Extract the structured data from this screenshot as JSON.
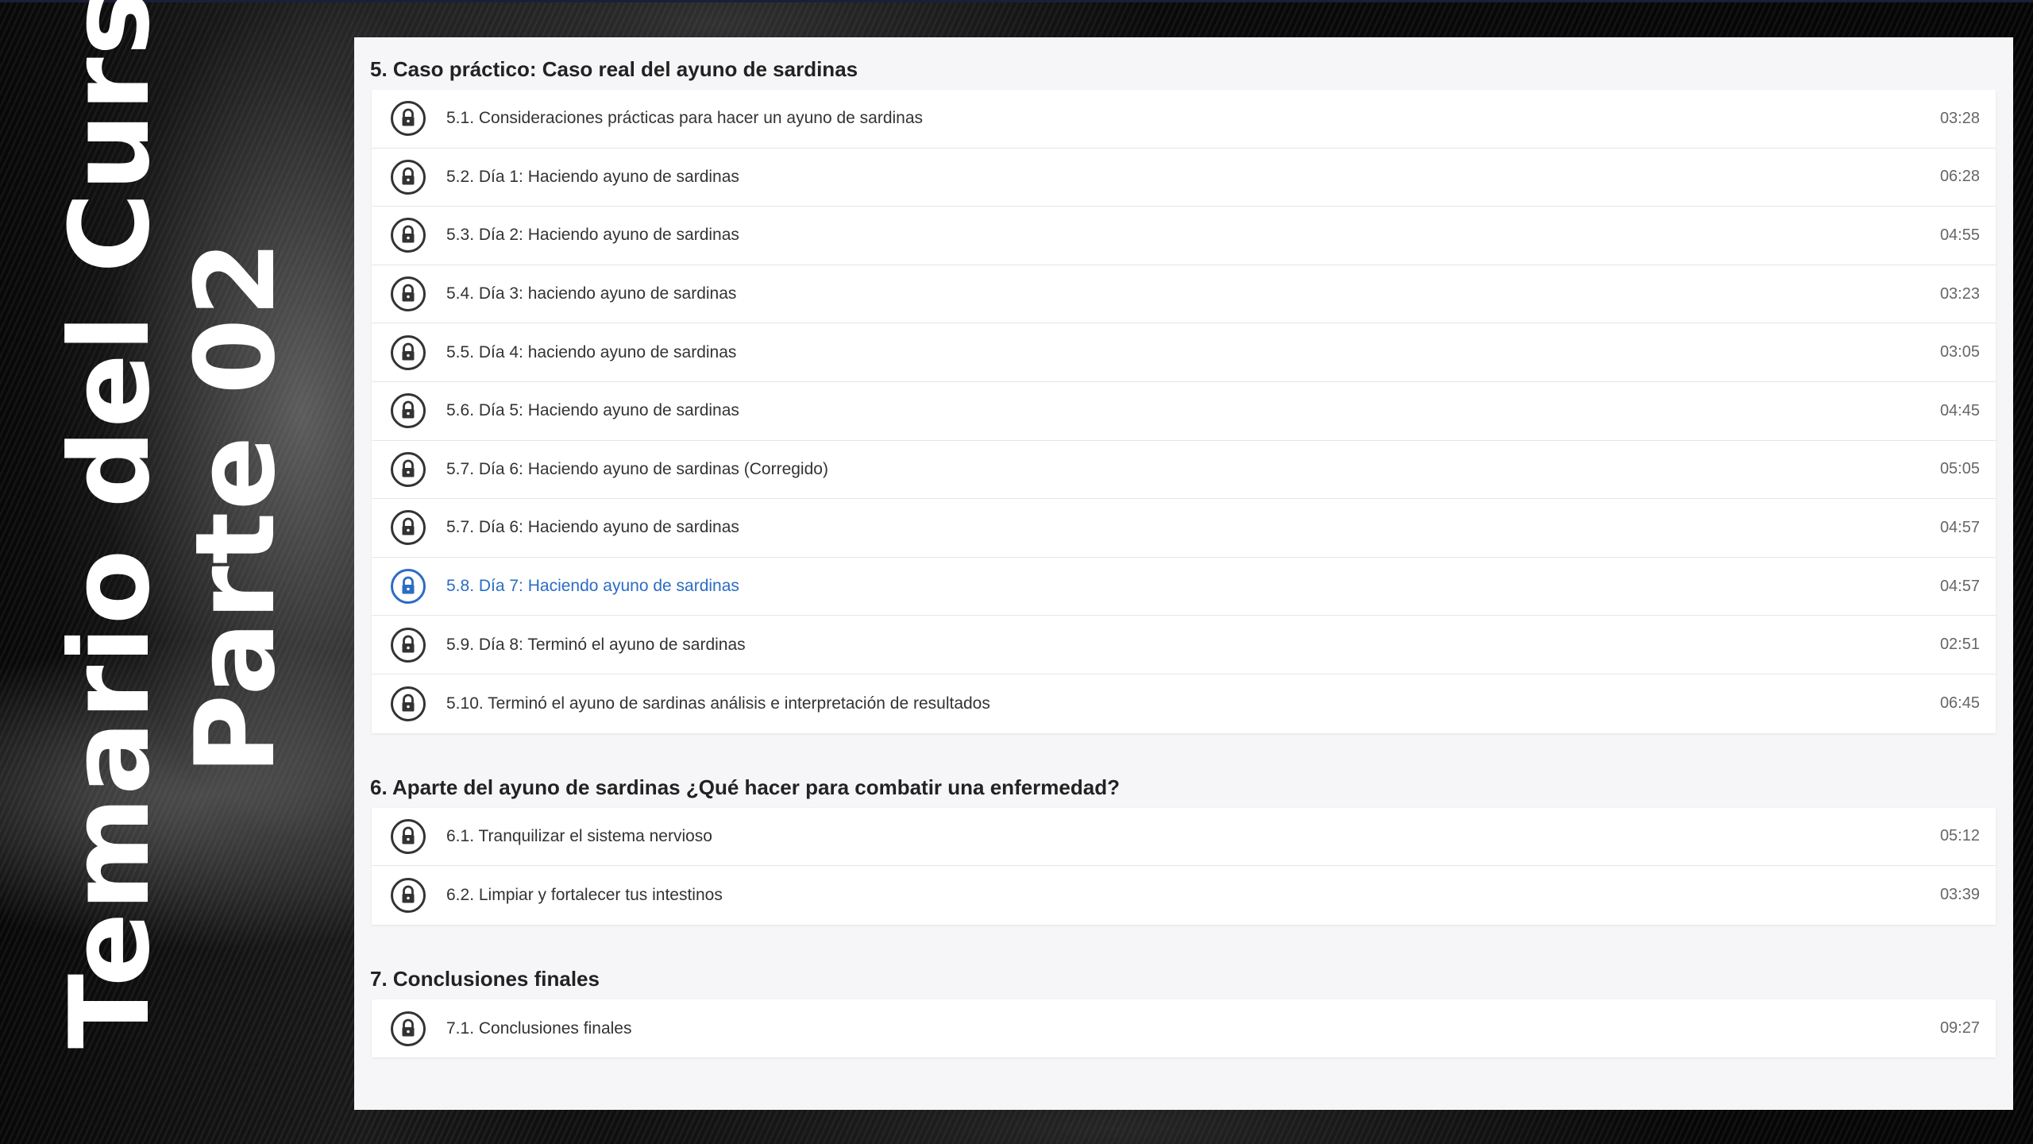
{
  "side_title": {
    "line1": "Temario del Curso",
    "line2": "Parte 02"
  },
  "colors": {
    "active": "#2b6cc4",
    "icon": "#333333"
  },
  "sections": [
    {
      "title": "5. Caso práctico: Caso real del ayuno de sardinas",
      "lessons": [
        {
          "title": "5.1. Consideraciones prácticas para hacer un ayuno de sardinas",
          "duration": "03:28",
          "icon": "lock-icon"
        },
        {
          "title": "5.2. Día 1: Haciendo ayuno de sardinas",
          "duration": "06:28",
          "icon": "lock-icon"
        },
        {
          "title": "5.3. Día 2: Haciendo ayuno de sardinas",
          "duration": "04:55",
          "icon": "lock-icon"
        },
        {
          "title": "5.4. Día 3: haciendo ayuno de sardinas",
          "duration": "03:23",
          "icon": "lock-icon"
        },
        {
          "title": "5.5. Día 4: haciendo ayuno de sardinas",
          "duration": "03:05",
          "icon": "lock-icon"
        },
        {
          "title": "5.6. Día 5: Haciendo ayuno de sardinas",
          "duration": "04:45",
          "icon": "lock-icon"
        },
        {
          "title": "5.7. Día 6: Haciendo ayuno de sardinas (Corregido)",
          "duration": "05:05",
          "icon": "lock-icon"
        },
        {
          "title": "5.7. Día 6: Haciendo ayuno de sardinas",
          "duration": "04:57",
          "icon": "lock-icon"
        },
        {
          "title": "5.8. Día 7: Haciendo ayuno de sardinas",
          "duration": "04:57",
          "icon": "lock-icon",
          "active": true
        },
        {
          "title": "5.9. Día 8: Terminó el ayuno de sardinas",
          "duration": "02:51",
          "icon": "lock-icon"
        },
        {
          "title": "5.10. Terminó el ayuno de sardinas análisis e interpretación de resultados",
          "duration": "06:45",
          "icon": "lock-icon"
        }
      ]
    },
    {
      "title": "6. Aparte del ayuno de sardinas ¿Qué hacer para combatir una enfermedad?",
      "lessons": [
        {
          "title": "6.1. Tranquilizar el sistema nervioso",
          "duration": "05:12",
          "icon": "lock-icon"
        },
        {
          "title": "6.2. Limpiar y fortalecer tus intestinos",
          "duration": "03:39",
          "icon": "lock-icon"
        }
      ]
    },
    {
      "title": "7. Conclusiones finales",
      "lessons": [
        {
          "title": "7.1. Conclusiones finales",
          "duration": "09:27",
          "icon": "lock-icon"
        }
      ]
    }
  ]
}
